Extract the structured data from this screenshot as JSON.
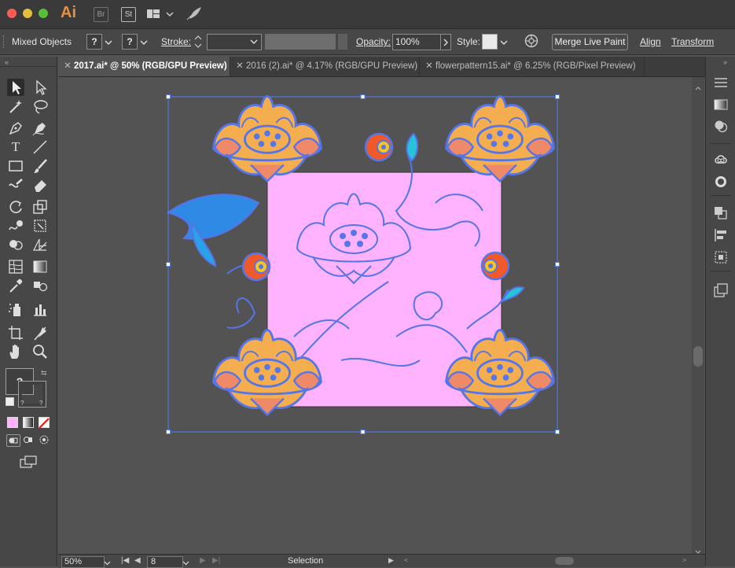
{
  "app": {
    "logo_text": "Ai",
    "bridge_label": "Br",
    "stock_label": "St"
  },
  "control_bar": {
    "selection_label": "Mixed Objects",
    "fill_swatch": "?",
    "stroke_swatch": "?",
    "stroke_label": "Stroke:",
    "opacity_label": "Opacity:",
    "opacity_value": "100%",
    "style_label": "Style:",
    "merge_live_paint_label": "Merge Live Paint",
    "align_label": "Align",
    "transform_label": "Transform"
  },
  "tabs": [
    {
      "label": "2017.ai* @ 50% (RGB/GPU Preview)",
      "active": true
    },
    {
      "label": "2016 (2).ai* @ 4.17% (RGB/GPU Preview)",
      "active": false
    },
    {
      "label": "flowerpattern15.ai* @ 6.25% (RGB/Pixel Preview)",
      "active": false
    }
  ],
  "toolbar": {
    "fill_stroke_label": "?",
    "mini_q": "?"
  },
  "status_bar": {
    "zoom": "50%",
    "artboard_number": "8",
    "tool_name": "Selection"
  },
  "colors": {
    "artboard_fill": "#ffb3ff",
    "flower_petal": "#f4ae4f",
    "flower_outline": "#5575e8",
    "accent_red": "#f0592a",
    "accent_yellow": "#f7c51e",
    "leaf_blue": "#2f8ae6",
    "bud_cyan": "#27c3d9"
  },
  "icons": [
    "selection-icon",
    "direct-selection-icon",
    "magic-wand-icon",
    "lasso-icon",
    "pen-icon",
    "curvature-icon",
    "type-icon",
    "line-icon",
    "rectangle-icon",
    "paintbrush-icon",
    "shaper-icon",
    "eraser-icon",
    "rotate-icon",
    "scale-icon",
    "warp-icon",
    "free-transform-icon",
    "shape-builder-icon",
    "perspective-icon",
    "mesh-icon",
    "gradient-icon",
    "eyedropper-icon",
    "blend-icon",
    "symbol-sprayer-icon",
    "column-graph-icon",
    "artboard-icon",
    "slice-icon",
    "hand-icon",
    "zoom-icon"
  ]
}
